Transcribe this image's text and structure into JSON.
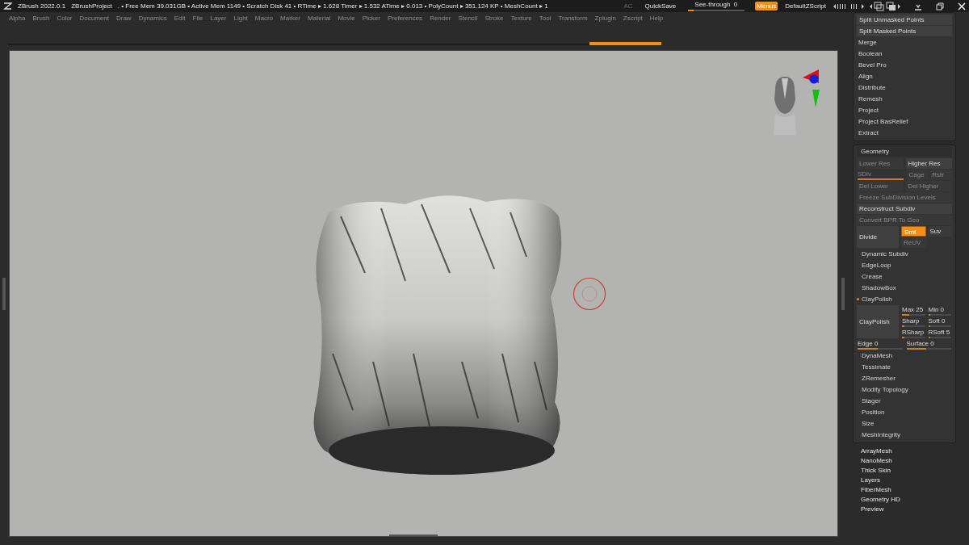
{
  "title_bar": {
    "app": "ZBrush 2022.0.1",
    "project": "ZBrushProject",
    "stats": ". • Free Mem 39.031GB • Active Mem 1149 • Scratch Disk 41 •  RTime ▸ 1.628 Timer ▸ 1.532 ATime ▸ 0.013 • PolyCount ▸ 351.124 KP  • MeshCount ▸ 1",
    "ac": "AC",
    "quicksave": "QuickSave",
    "see_through": {
      "label": "See-through",
      "reading": "0",
      "level": 0.1
    },
    "menus": {
      "label": "Menus",
      "selected": true
    },
    "script": "DefaultZScript"
  },
  "menu_bar": [
    "Alpha",
    "Brush",
    "Color",
    "Document",
    "Draw",
    "Dynamics",
    "Edit",
    "File",
    "Layer",
    "Light",
    "Macro",
    "Marker",
    "Material",
    "Movie",
    "Picker",
    "Preferences",
    "Render",
    "Stencil",
    "Stroke",
    "Texture",
    "Tool",
    "Transform",
    "Zplugin",
    "Zscript",
    "Help"
  ],
  "progress": {
    "level": 1
  },
  "subtool_panel": {
    "buttons": [
      "Split Unmasked Points",
      "Split Masked Points"
    ],
    "items": [
      "Merge",
      "Boolean",
      "Bevel Pro",
      "Align",
      "Distribute",
      "Remesh",
      "Project",
      "Project BasRelief",
      "Extract"
    ]
  },
  "geometry_panel": {
    "title": "Geometry",
    "rows": [
      {
        "kind": "cells",
        "cells": [
          {
            "kind": "button",
            "label": "Lower Res",
            "disabled": true,
            "selected": false
          },
          {
            "kind": "button",
            "label": "Higher Res",
            "disabled": false,
            "selected": false
          }
        ]
      },
      {
        "kind": "cells",
        "cells": [
          {
            "kind": "slider",
            "label": "SDiv",
            "level": 1,
            "disabled": true
          },
          {
            "kind": "pair",
            "labels": [
              "Cage",
              "Rstr"
            ],
            "disabled": true
          }
        ]
      },
      {
        "kind": "cells",
        "cells": [
          {
            "kind": "button",
            "label": "Del Lower",
            "disabled": true,
            "selected": false
          },
          {
            "kind": "button",
            "label": "Del Higher",
            "disabled": true,
            "selected": false
          }
        ]
      },
      {
        "kind": "cells",
        "cells": [
          {
            "kind": "button",
            "label": "Freeze SubDivision Levels",
            "disabled": true,
            "selected": false
          }
        ]
      },
      {
        "kind": "cells",
        "cells": [
          {
            "kind": "button",
            "label": "Reconstruct Subdiv",
            "disabled": false,
            "selected": false
          }
        ]
      },
      {
        "kind": "cells",
        "cells": [
          {
            "kind": "button",
            "label": "Convert BPR To Geo",
            "disabled": true,
            "selected": false
          }
        ]
      },
      {
        "kind": "block",
        "label": "Divide",
        "cells": [
          {
            "kind": "button",
            "label": "Smt",
            "disabled": false,
            "selected": true
          },
          {
            "kind": "button",
            "label": "Suv",
            "disabled": false,
            "selected": false
          },
          {
            "kind": "button",
            "label": "ReUV",
            "disabled": true,
            "selected": false
          }
        ]
      },
      {
        "kind": "item",
        "label": "Dynamic Subdiv",
        "marked": false
      },
      {
        "kind": "item",
        "label": "EdgeLoop",
        "marked": false
      },
      {
        "kind": "item",
        "label": "Crease",
        "marked": false
      },
      {
        "kind": "item",
        "label": "ShadowBox",
        "marked": false
      },
      {
        "kind": "item",
        "label": "ClayPolish",
        "marked": true
      },
      {
        "kind": "block",
        "label": "ClayPolish",
        "cells": [
          {
            "kind": "slider",
            "label": "Max 25",
            "level": 0.3,
            "disabled": false
          },
          {
            "kind": "slider",
            "label": "Min 0",
            "level": 0.1,
            "disabled": false
          },
          {
            "kind": "slider",
            "label": "Sharp",
            "level": 0.1,
            "disabled": false
          },
          {
            "kind": "slider",
            "label": "Soft 0",
            "level": 0.1,
            "disabled": false
          },
          {
            "kind": "slider",
            "label": "RSharp",
            "level": 0.1,
            "disabled": false
          },
          {
            "kind": "slider",
            "label": "RSoft 5",
            "level": 0.1,
            "disabled": false
          }
        ]
      },
      {
        "kind": "cells",
        "cells": [
          {
            "kind": "slider",
            "label": "Edge 0",
            "level": 0.45,
            "disabled": false
          },
          {
            "kind": "slider",
            "label": "Surface 0",
            "level": 0.45,
            "disabled": false
          }
        ]
      },
      {
        "kind": "item",
        "label": "DynaMesh",
        "marked": false
      },
      {
        "kind": "item",
        "label": "Tessimate",
        "marked": false
      },
      {
        "kind": "item",
        "label": "ZRemesher",
        "marked": false
      },
      {
        "kind": "item",
        "label": "Modify Topology",
        "marked": false
      },
      {
        "kind": "item",
        "label": "Stager",
        "marked": false
      },
      {
        "kind": "item",
        "label": "Position",
        "marked": false
      },
      {
        "kind": "item",
        "label": "Size",
        "marked": false
      },
      {
        "kind": "item",
        "label": "MeshIntegrity",
        "marked": false
      }
    ]
  },
  "tool_list": [
    "ArrayMesh",
    "NanoMesh",
    "Thick Skin",
    "Layers",
    "FiberMesh",
    "Geometry HD",
    "Preview"
  ]
}
